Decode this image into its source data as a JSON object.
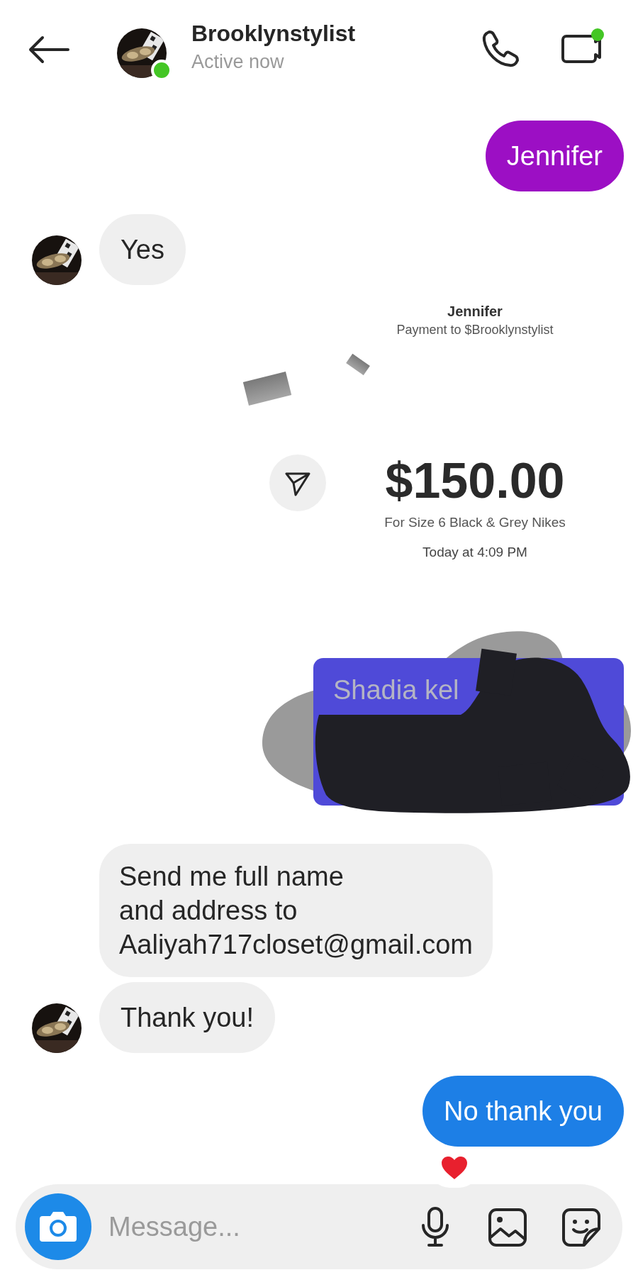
{
  "header": {
    "name": "Brooklynstylist",
    "status": "Active now",
    "online": true,
    "video_dot": true
  },
  "messages": [
    {
      "kind": "text",
      "outgoing": true,
      "text": "Jennifer",
      "color": "#9c0fc4",
      "reacted": false
    },
    {
      "kind": "text",
      "outgoing": false,
      "text": "Yes",
      "avatar": true
    },
    {
      "kind": "payment",
      "recipient": "Jennifer",
      "payee": "Payment to $Brooklynstylist",
      "amount": "$150.00",
      "note": "For Size 6 Black & Grey Nikes",
      "time": "Today at 4:09 PM"
    },
    {
      "kind": "redacted",
      "outgoing": true,
      "text": "Shadia kel"
    },
    {
      "kind": "text",
      "outgoing": false,
      "text": "Send me full name\nand address to\nAaliyah717closet@gmail.com",
      "avatar": false
    },
    {
      "kind": "text",
      "outgoing": false,
      "text": "Thank you!",
      "avatar": true
    },
    {
      "kind": "text",
      "outgoing": true,
      "text": "No thank you",
      "color": "#1d7fe6",
      "reacted": true
    }
  ],
  "composer": {
    "placeholder": "Message..."
  }
}
